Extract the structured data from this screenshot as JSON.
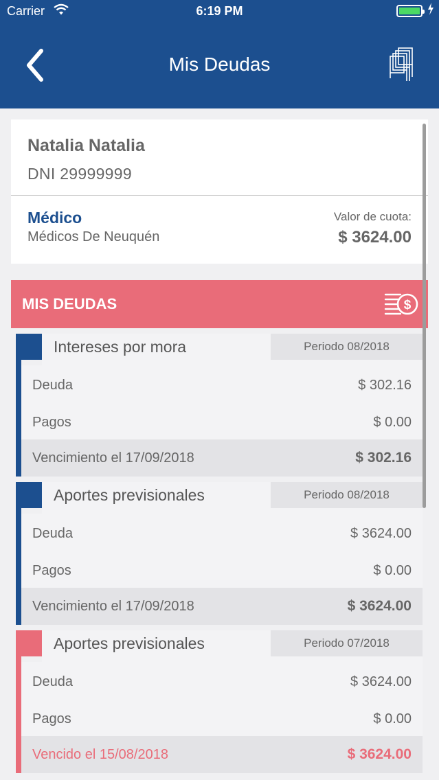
{
  "status_bar": {
    "carrier": "Carrier",
    "time": "6:19 PM"
  },
  "nav": {
    "title": "Mis Deudas",
    "back_icon": "chevron-left-icon",
    "logo_icon": "institution-logo-icon"
  },
  "profile": {
    "name": "Natalia Natalia",
    "dni": "DNI 29999999",
    "role": "Médico",
    "organization": "Médicos De Neuquén",
    "cuota_label": "Valor de cuota:",
    "cuota_value": "$ 3624.00"
  },
  "deudas_section": {
    "title": "MIS DEUDAS",
    "icon": "money-list-icon"
  },
  "debts": [
    {
      "concept": "Intereses por mora",
      "periodo": "Periodo 08/2018",
      "deuda_label": "Deuda",
      "deuda_value": "$ 302.16",
      "pagos_label": "Pagos",
      "pagos_value": "$ 0.00",
      "due_label": "Vencimiento el 17/09/2018",
      "due_value": "$ 302.16",
      "status_color": "#1c4f8f"
    },
    {
      "concept": "Aportes previsionales",
      "periodo": "Periodo 08/2018",
      "deuda_label": "Deuda",
      "deuda_value": "$ 3624.00",
      "pagos_label": "Pagos",
      "pagos_value": "$ 0.00",
      "due_label": "Vencimiento el 17/09/2018",
      "due_value": "$ 3624.00",
      "status_color": "#1c4f8f"
    },
    {
      "concept": "Aportes previsionales",
      "periodo": "Periodo 07/2018",
      "deuda_label": "Deuda",
      "deuda_value": "$ 3624.00",
      "pagos_label": "Pagos",
      "pagos_value": "$ 0.00",
      "due_label": "Vencido el 15/08/2018",
      "due_value": "$ 3624.00",
      "status_color": "#e96c79"
    }
  ],
  "colors": {
    "primary": "#1c4f8f",
    "accent": "#e96c79",
    "background": "#f0f0f2"
  }
}
